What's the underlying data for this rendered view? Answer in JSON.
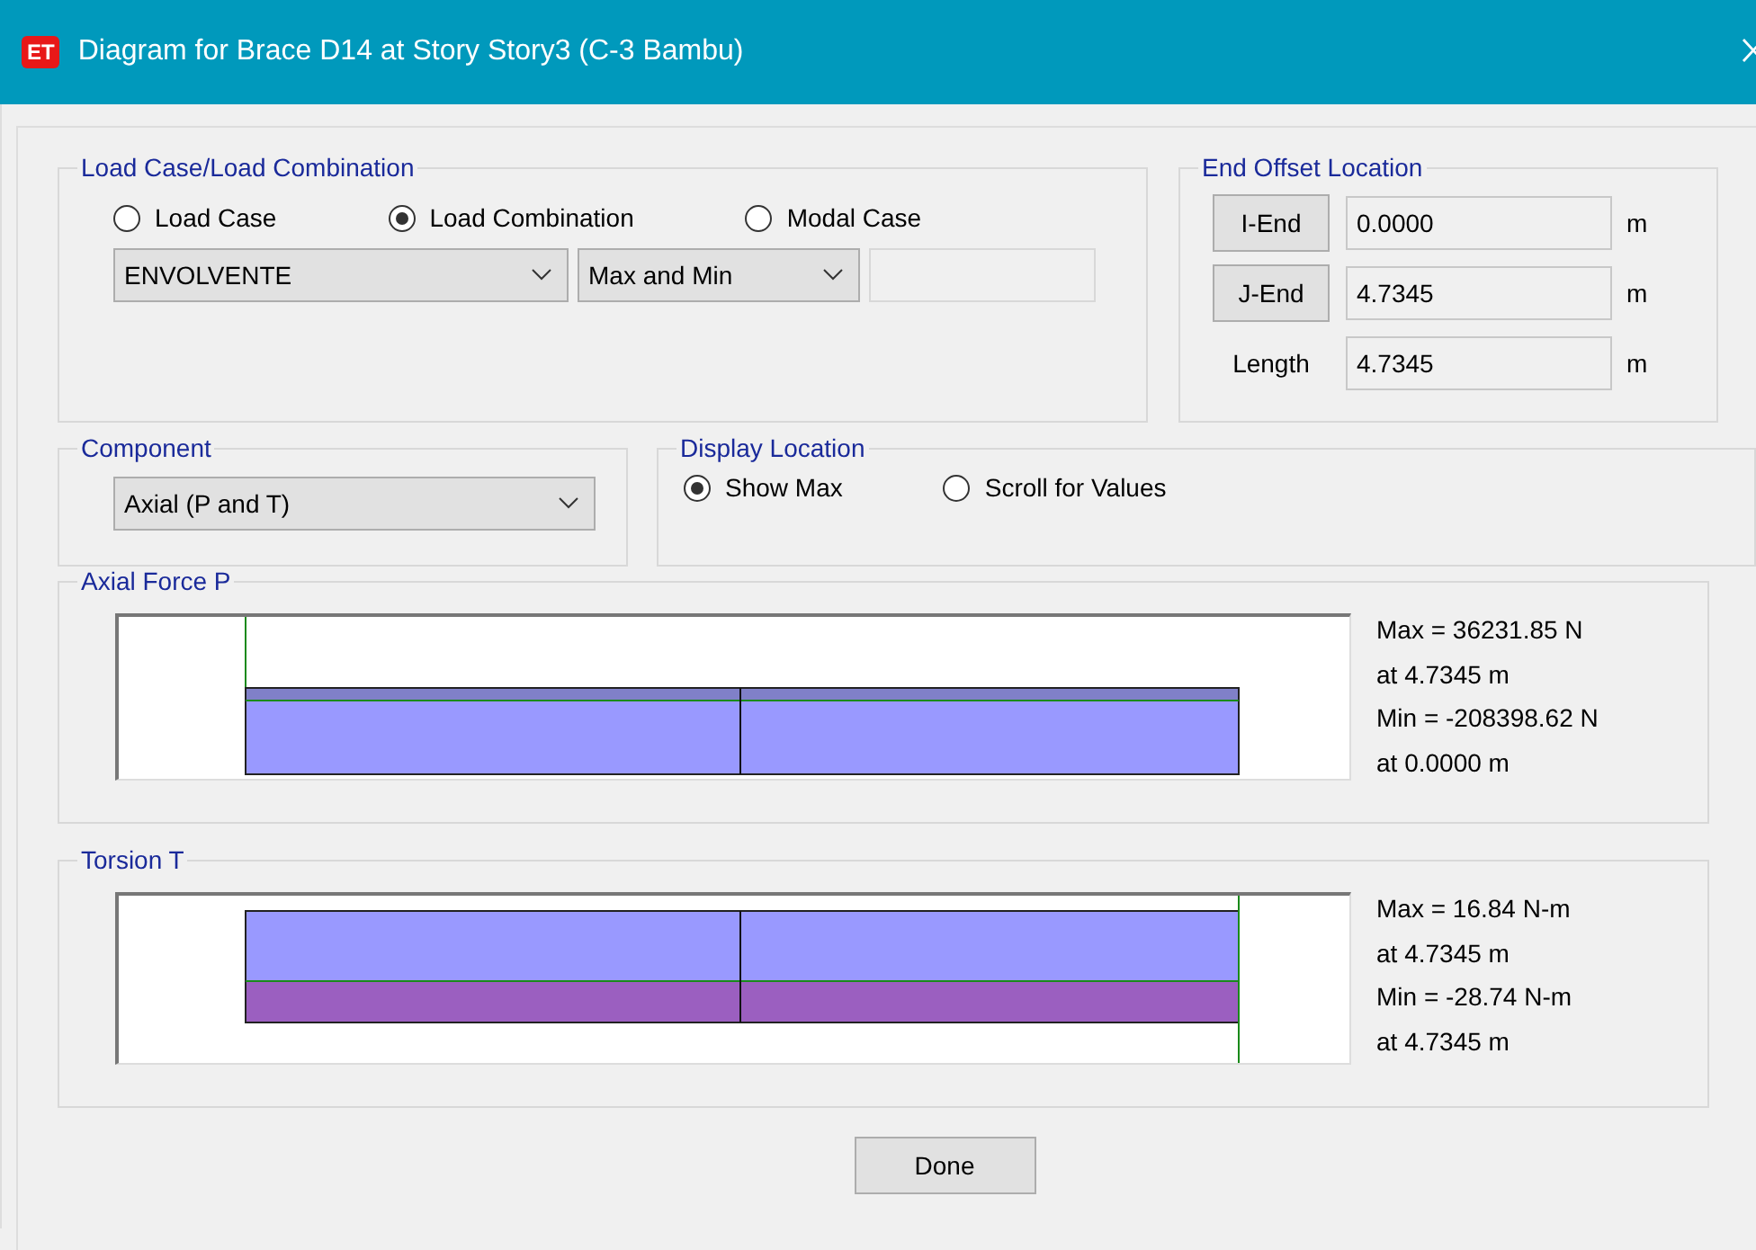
{
  "window": {
    "icon_text": "ET",
    "title": "Diagram for Brace D14 at Story Story3 (C-3 Bambu)"
  },
  "load_case": {
    "title": "Load Case/Load Combination",
    "options": [
      {
        "label": "Load Case",
        "selected": false
      },
      {
        "label": "Load Combination",
        "selected": true
      },
      {
        "label": "Modal Case",
        "selected": false
      }
    ],
    "combination": "ENVOLVENTE",
    "mode": "Max and Min"
  },
  "end_offset": {
    "title": "End Offset Location",
    "rows": [
      {
        "kind": "button",
        "label": "I-End",
        "value": "0.0000",
        "unit": "m"
      },
      {
        "kind": "button",
        "label": "J-End",
        "value": "4.7345",
        "unit": "m"
      },
      {
        "kind": "label",
        "label": "Length",
        "value": "4.7345",
        "unit": "m"
      }
    ]
  },
  "component": {
    "title": "Component",
    "value": "Axial (P and T)"
  },
  "display_location": {
    "title": "Display Location",
    "options": [
      {
        "label": "Show Max",
        "selected": true
      },
      {
        "label": "Scroll for Values",
        "selected": false
      }
    ]
  },
  "diagrams": [
    {
      "kind": "axial",
      "title": "Axial Force P",
      "readouts": [
        "Max = 36231.85 N",
        "at 4.7345 m",
        "Min = -208398.62 N",
        "at 0.0000 m"
      ]
    },
    {
      "kind": "torsion",
      "title": "Torsion T",
      "readouts": [
        "Max = 16.84 N-m",
        "at 4.7345 m",
        "Min = -28.74 N-m",
        "at 4.7345 m"
      ]
    }
  ],
  "buttons": [
    "Done"
  ]
}
